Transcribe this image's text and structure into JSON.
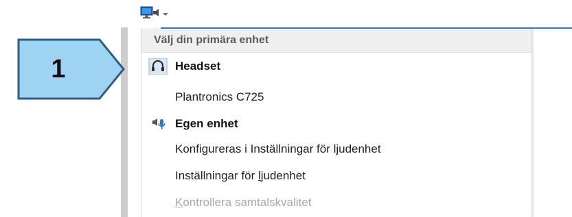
{
  "toolbar": {
    "device_button_icon": "monitor-icon",
    "dropdown_icon": "chevron-down-icon"
  },
  "callout": {
    "number": "1",
    "fill": "#9fd3f2",
    "stroke": "#2b5d8c"
  },
  "menu": {
    "header": "Välj din primära enhet",
    "accent": "#2f7cc2",
    "items": [
      {
        "label": "Headset",
        "bold": true,
        "icon": "headset-icon",
        "selected": true
      },
      {
        "label": "Plantronics C725",
        "bold": false,
        "icon": null
      },
      {
        "label": "Egen enhet",
        "bold": true,
        "icon": "speaker-microphone-icon"
      },
      {
        "label": "Konfigureras i Inställningar för ljudenhet",
        "bold": false,
        "icon": null
      },
      {
        "label_pre": "Inställningar för ",
        "label_u": "l",
        "label_post": "judenhet",
        "bold": false,
        "icon": null
      },
      {
        "label_u": "K",
        "label_post": "ontrollera samtalskvalitet",
        "bold": false,
        "icon": null,
        "disabled": true
      }
    ]
  }
}
